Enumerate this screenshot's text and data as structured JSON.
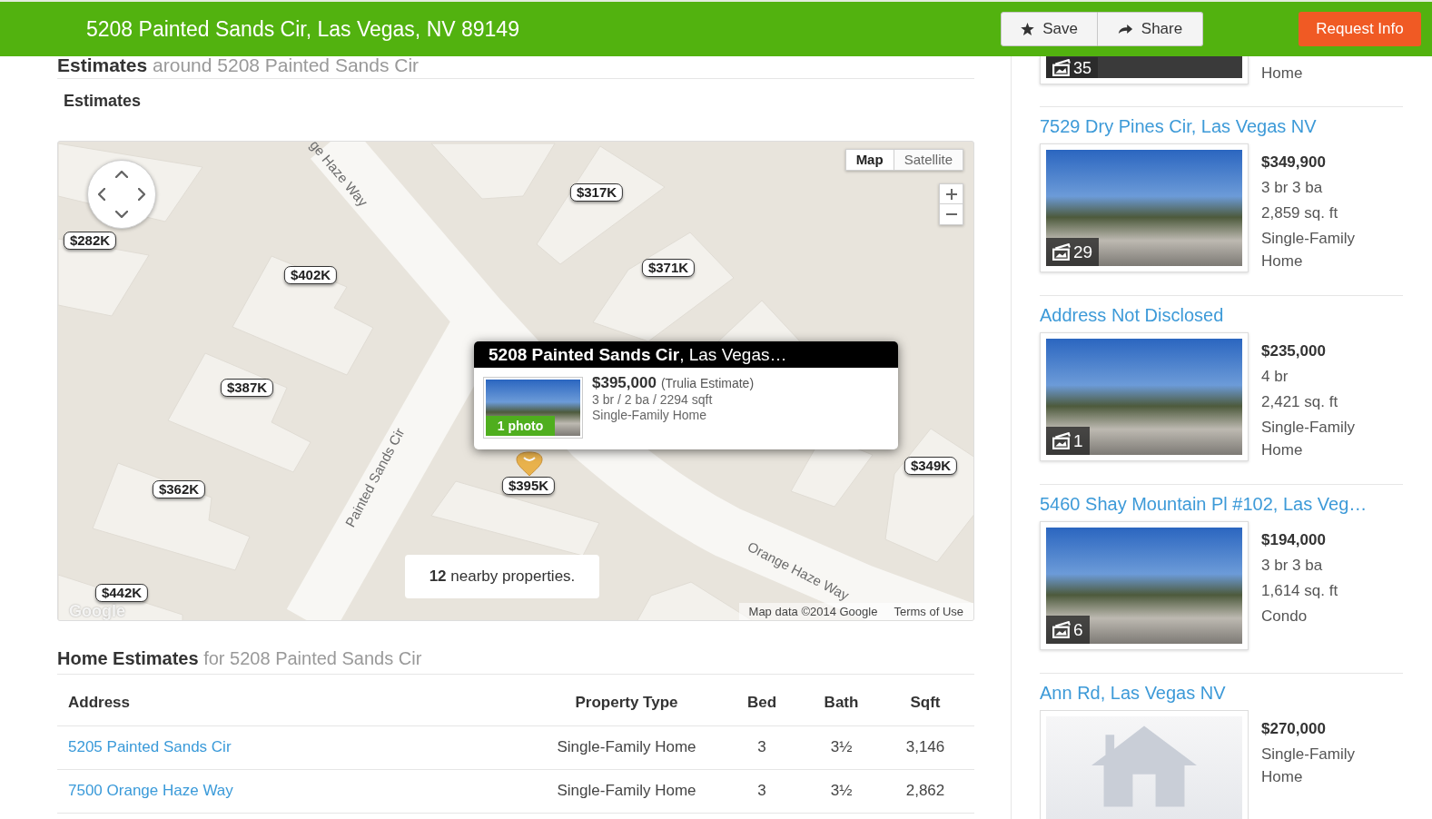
{
  "header": {
    "title": "5208 Painted Sands Cir, Las Vegas, NV 89149",
    "buttons": [
      "Save",
      "Share"
    ],
    "request_button": "Request Info"
  },
  "estimates": {
    "heading": "**Estimates** around 5208 Painted Sands Cir",
    "subheading": "Estimates"
  },
  "map": {
    "view_tabs": [
      {
        "label": "Map",
        "selected": true
      },
      {
        "label": "Satellite",
        "selected": false
      }
    ],
    "street_labels": [
      "ge Haze Way",
      "Painted Sands Cir",
      "Orange Haze Way"
    ],
    "price_tags": [
      "$317K",
      "$282K",
      "$371K",
      "$402K",
      "$387K",
      "$349K",
      "$395K",
      "$362K",
      "$442K"
    ],
    "popup": {
      "title": "**5208 Painted Sands Cir**, Las Vegas…",
      "photo_badge": "1 photo",
      "price": "$395,000",
      "price_note": "(Trulia Estimate)",
      "details": "3 br / 2 ba / 2294 sqft",
      "property_type": "Single-Family Home"
    },
    "nearby_notice": "**12** nearby properties.",
    "logo": "Google",
    "attribution": "Map data ©2014 Google",
    "terms_link": "Terms of Use"
  },
  "home_estimates": {
    "heading": "**Home Estimates** for 5208 Painted Sands Cir",
    "columns": [
      "Address",
      "Property Type",
      "Bed",
      "Bath",
      "Sqft"
    ],
    "rows": [
      [
        "5205 Painted Sands Cir",
        "Single-Family Home",
        "3",
        "3½",
        "3,146"
      ],
      [
        "7500 Orange Haze Way",
        "Single-Family Home",
        "3",
        "3½",
        "2,862"
      ]
    ]
  },
  "nearby_listings": [
    {
      "kind": "partial",
      "photo_count": "35",
      "details": [
        "Home"
      ]
    },
    {
      "kind": "photo",
      "title": "7529 Dry Pines Cir, Las Vegas NV",
      "photo_count": "29",
      "price": "$349,900",
      "details": [
        "3 br 3 ba",
        "2,859 sq. ft",
        "Single-Family Home"
      ]
    },
    {
      "kind": "photo",
      "title": "Address Not Disclosed",
      "photo_count": "1",
      "price": "$235,000",
      "details": [
        "4 br",
        "2,421 sq. ft",
        "Single-Family Home"
      ]
    },
    {
      "kind": "photo",
      "title": "5460 Shay Mountain Pl #102, Las Veg…",
      "photo_count": "6",
      "price": "$194,000",
      "details": [
        "3 br 3 ba",
        "1,614 sq. ft",
        "Condo"
      ]
    },
    {
      "kind": "no_photo",
      "title": "Ann Rd, Las Vegas NV",
      "price": "$270,000",
      "details": [
        "Single-Family Home"
      ]
    }
  ]
}
